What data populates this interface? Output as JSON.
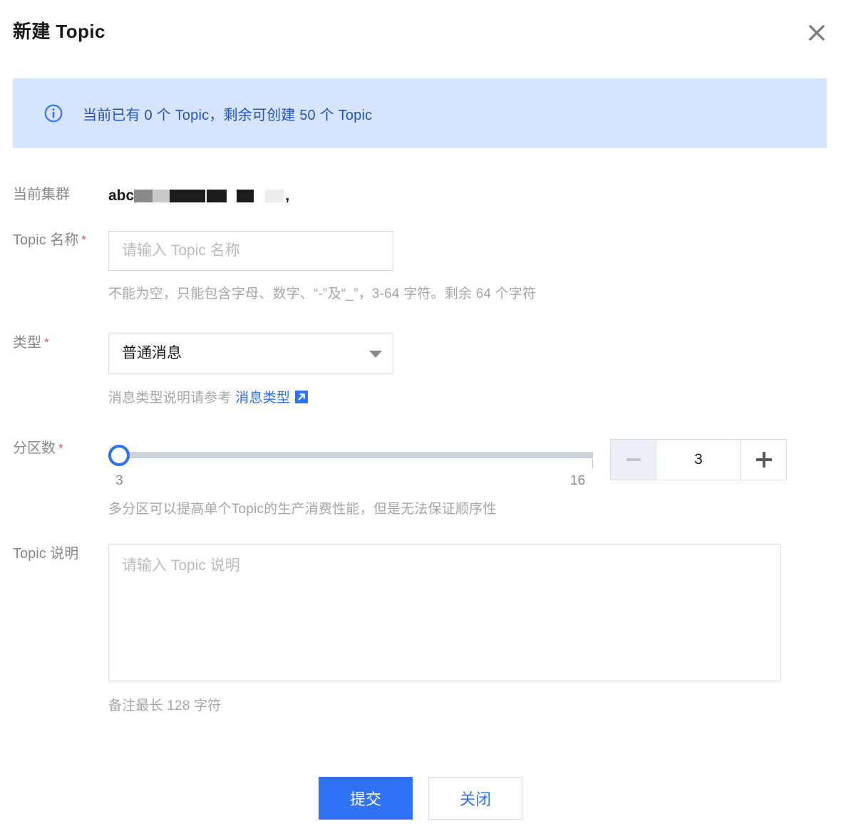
{
  "dialog": {
    "title": "新建 Topic",
    "close_icon": "close-icon"
  },
  "banner": {
    "icon": "info-circle-icon",
    "text": "当前已有 0 个 Topic，剩余可创建 50 个 Topic",
    "existing_count": "0",
    "remaining_count": "50",
    "background_color": "#d6e4ff",
    "text_color": "#2253c4"
  },
  "form": {
    "cluster": {
      "label": "当前集群",
      "value_prefix": "abc",
      "value_tail": ",",
      "redacted": true
    },
    "topic_name": {
      "label": "Topic 名称",
      "required": true,
      "value": "",
      "placeholder": "请输入 Topic 名称",
      "helper": "不能为空，只能包含字母、数字、“-”及“_”，3-64 字符。剩余 64 个字符"
    },
    "type": {
      "label": "类型",
      "required": true,
      "selected": "普通消息",
      "options": [
        "普通消息"
      ],
      "caret_icon": "chevron-down-icon",
      "helper_prefix": "消息类型说明请参考",
      "helper_link": "消息类型",
      "link_icon": "external-link-icon"
    },
    "partitions": {
      "label": "分区数",
      "required": true,
      "value": "3",
      "min_label": "3",
      "max_label": "16",
      "min": 3,
      "max": 16,
      "helper": "多分区可以提高单个Topic的生产消费性能，但是无法保证顺序性",
      "minus_label": "−",
      "plus_label": "+",
      "minus_disabled": true,
      "handle_color": "#2f72f5",
      "track_color": "#ccd2de"
    },
    "description": {
      "label": "Topic 说明",
      "required": false,
      "value": "",
      "placeholder": "请输入 Topic 说明",
      "helper": "备注最长 128 字符"
    }
  },
  "footer": {
    "submit_label": "提交",
    "close_label": "关闭",
    "primary_color": "#2f72f5"
  }
}
